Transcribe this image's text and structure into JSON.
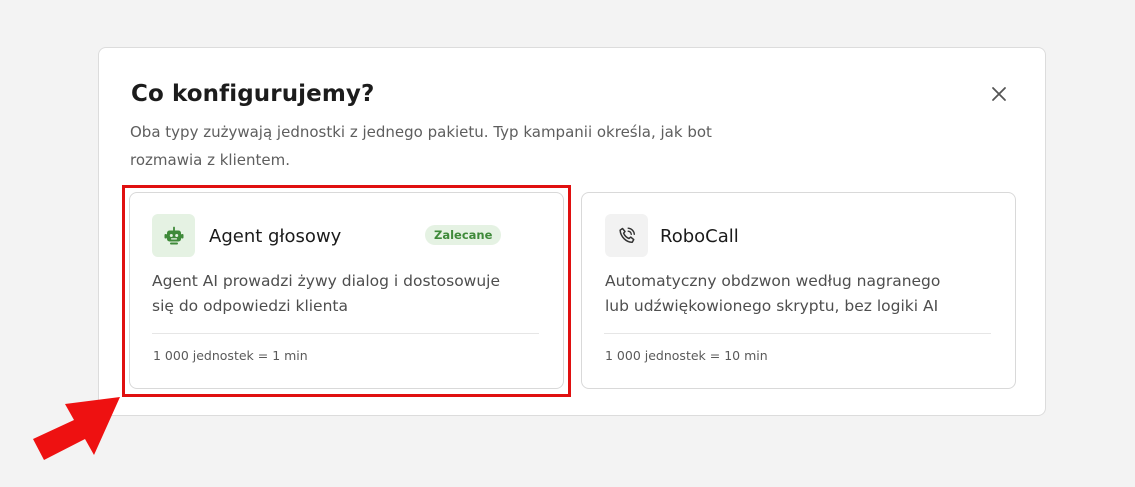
{
  "modal": {
    "title": "Co konfigurujemy?",
    "subtitle": "Oba typy zużywają jednostki z jednego pakietu. Typ kampanii określa, jak bot rozmawia z klientem."
  },
  "options": [
    {
      "name": "Agent głosowy",
      "badge": "Zalecane",
      "description": "Agent AI prowadzi żywy dialog i dostosowuje się do odpowiedzi klienta",
      "cost": "1 000 jednostek = 1 min",
      "icon": "robot-icon",
      "highlighted": true
    },
    {
      "name": "RoboCall",
      "description": "Automatyczny obdzwon według nagranego lub udźwiękowionego skryptu, bez logiki AI",
      "cost": "1 000 jednostek = 10 min",
      "icon": "phone-call-icon"
    }
  ],
  "colors": {
    "accent_green": "#3f8a3a",
    "badge_bg": "#e5f2e3",
    "highlight_red": "#e01010"
  }
}
